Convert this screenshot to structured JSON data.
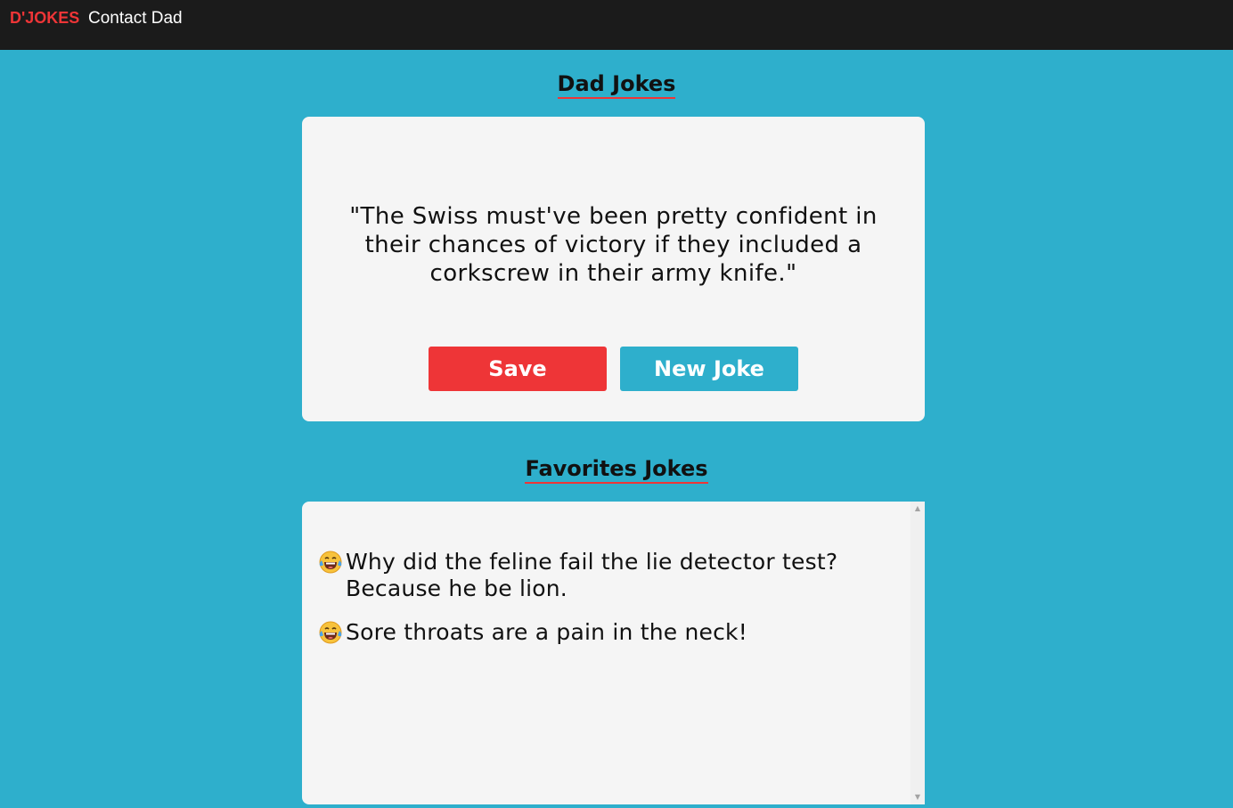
{
  "navbar": {
    "brand": "D'JOKES",
    "link": "Contact Dad"
  },
  "dad_jokes": {
    "title": "Dad Jokes",
    "joke": "\"The Swiss must've been pretty confident in their chances of victory if they included a corkscrew in their army knife.\"",
    "save_label": "Save",
    "new_joke_label": "New Joke"
  },
  "favorites": {
    "title": "Favorites Jokes",
    "items": [
      {
        "icon": "laughing-tears-emoji-icon",
        "text": "Why did the feline fail the lie detector test? Because he be lion."
      },
      {
        "icon": "laughing-tears-emoji-icon",
        "text": "Sore throats are a pain in the neck!"
      }
    ]
  },
  "colors": {
    "background": "#2eafcc",
    "navbar": "#1b1b1b",
    "accent_red": "#ee3537",
    "card": "#f5f5f5"
  }
}
